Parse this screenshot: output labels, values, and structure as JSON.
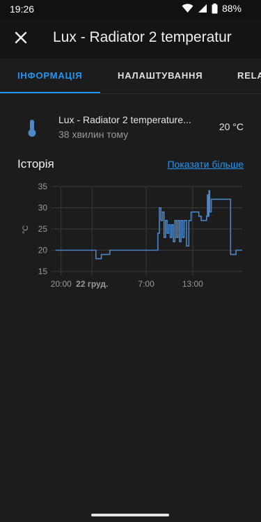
{
  "status": {
    "time": "19:26",
    "battery": "88%"
  },
  "header": {
    "title": "Lux - Radiator 2 temperatur"
  },
  "tabs": [
    {
      "label": "ІНФОРМАЦІЯ"
    },
    {
      "label": "НАЛАШТУВАННЯ"
    },
    {
      "label": "RELA"
    }
  ],
  "entity": {
    "name": "Lux - Radiator 2 temperature...",
    "last_changed": "38 хвилин тому",
    "state": "20 °C"
  },
  "history": {
    "title": "Історія",
    "show_more": "Показати більше"
  },
  "colors": {
    "accent": "#2196f3",
    "series": "#4a86c8",
    "background": "#1c1c1c"
  },
  "chart_data": {
    "type": "line",
    "ylabel": "°C",
    "ylim": [
      15,
      35
    ],
    "yticks": [
      15,
      20,
      25,
      30,
      35
    ],
    "xtick_labels": [
      "20:00",
      "22 груд.",
      "7:00",
      "13:00"
    ],
    "x_domain_hours": [
      19.3,
      43.4
    ],
    "xtick_hours": [
      20,
      24,
      31,
      37
    ],
    "series": [
      {
        "step": true,
        "points": [
          [
            19.3,
            20
          ],
          [
            24.5,
            20
          ],
          [
            24.5,
            18
          ],
          [
            25.2,
            18
          ],
          [
            25.2,
            19
          ],
          [
            26.3,
            19
          ],
          [
            26.3,
            20
          ],
          [
            32.5,
            20
          ],
          [
            32.5,
            24
          ],
          [
            32.7,
            24
          ],
          [
            32.7,
            30
          ],
          [
            32.9,
            30
          ],
          [
            32.9,
            27
          ],
          [
            33.1,
            27
          ],
          [
            33.1,
            29
          ],
          [
            33.3,
            29
          ],
          [
            33.3,
            23
          ],
          [
            33.5,
            23
          ],
          [
            33.5,
            27
          ],
          [
            33.7,
            27
          ],
          [
            33.7,
            24
          ],
          [
            33.9,
            24
          ],
          [
            33.9,
            26
          ],
          [
            34.1,
            26
          ],
          [
            34.1,
            23
          ],
          [
            34.3,
            23
          ],
          [
            34.3,
            26
          ],
          [
            34.5,
            26
          ],
          [
            34.5,
            22
          ],
          [
            34.7,
            22
          ],
          [
            34.7,
            27
          ],
          [
            34.9,
            27
          ],
          [
            34.9,
            23
          ],
          [
            35.1,
            23
          ],
          [
            35.1,
            27
          ],
          [
            35.3,
            27
          ],
          [
            35.3,
            22
          ],
          [
            35.5,
            22
          ],
          [
            35.5,
            27
          ],
          [
            35.7,
            27
          ],
          [
            35.7,
            23
          ],
          [
            35.9,
            23
          ],
          [
            35.9,
            27
          ],
          [
            36.2,
            27
          ],
          [
            36.2,
            21
          ],
          [
            36.5,
            21
          ],
          [
            36.5,
            27
          ],
          [
            36.8,
            27
          ],
          [
            36.8,
            29
          ],
          [
            37.8,
            29
          ],
          [
            37.8,
            28
          ],
          [
            38.1,
            28
          ],
          [
            38.1,
            27
          ],
          [
            38.8,
            27
          ],
          [
            38.8,
            28
          ],
          [
            38.9,
            28
          ],
          [
            38.9,
            33
          ],
          [
            39.0,
            33
          ],
          [
            39.0,
            28
          ],
          [
            39.1,
            28
          ],
          [
            39.1,
            34
          ],
          [
            39.2,
            34
          ],
          [
            39.2,
            29
          ],
          [
            39.4,
            29
          ],
          [
            39.4,
            32
          ],
          [
            41.9,
            32
          ],
          [
            41.9,
            19
          ],
          [
            42.6,
            19
          ],
          [
            42.6,
            20
          ],
          [
            43.4,
            20
          ]
        ]
      }
    ],
    "grid": true
  }
}
